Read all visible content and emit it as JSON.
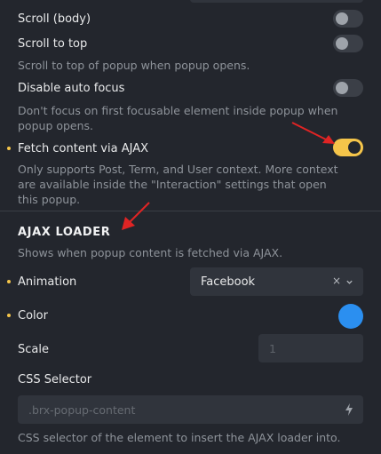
{
  "controls": {
    "scroll_body": {
      "label": "Scroll (body)",
      "enabled": false
    },
    "scroll_to_top": {
      "label": "Scroll to top",
      "description": "Scroll to top of popup when popup opens.",
      "enabled": false
    },
    "disable_auto_focus": {
      "label": "Disable auto focus",
      "description": "Don't focus on first focusable element inside popup when popup opens.",
      "enabled": false
    },
    "fetch_ajax": {
      "label": "Fetch content via AJAX",
      "description": "Only supports Post, Term, and User context. More context are available inside the \"Interaction\" settings that open this popup.",
      "enabled": true
    }
  },
  "ajax_loader": {
    "title": "AJAX LOADER",
    "description": "Shows when popup content is fetched via AJAX.",
    "animation": {
      "label": "Animation",
      "value": "Facebook",
      "clear": "×"
    },
    "color": {
      "label": "Color",
      "value": "#2b8ff0"
    },
    "scale": {
      "label": "Scale",
      "placeholder": "1"
    },
    "css_selector": {
      "label": "CSS Selector",
      "placeholder": ".brx-popup-content",
      "description": "CSS selector of the element to insert the AJAX loader into."
    }
  },
  "colors": {
    "accent": "#f5c54a",
    "background": "#23262d",
    "annotation_arrow": "#e02424"
  }
}
